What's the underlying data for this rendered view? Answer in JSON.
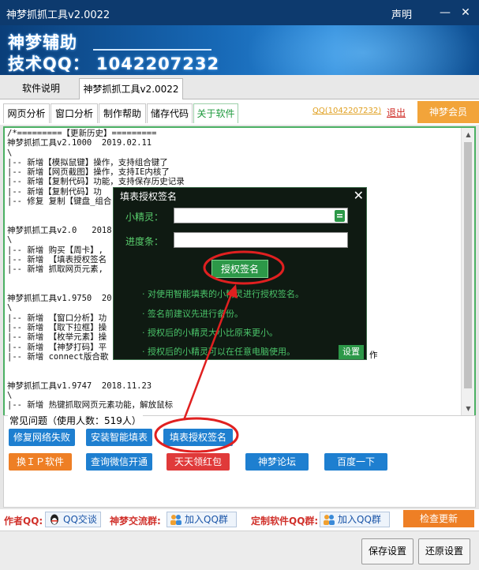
{
  "window": {
    "title": "神梦抓抓工具v2.0022",
    "declaration": "声明",
    "minimize": "—",
    "close": "✕"
  },
  "banner": {
    "line1": "神梦辅助",
    "line2": "技术QQ： 1042207232"
  },
  "top_tabs": [
    {
      "label": "软件说明",
      "selected": false
    },
    {
      "label": "神梦抓抓工具v2.0022",
      "selected": true
    }
  ],
  "sub_tabs": [
    {
      "label": "网页分析",
      "selected": false
    },
    {
      "label": "窗口分析",
      "selected": false
    },
    {
      "label": "制作帮助",
      "selected": false
    },
    {
      "label": "储存代码",
      "selected": false
    },
    {
      "label": "关于软件",
      "selected": true
    }
  ],
  "header_links": {
    "qq": "QQ(1042207232)",
    "exit": "退出",
    "member": "神梦会员"
  },
  "history_text": "/*=========【更新历史】=========\n神梦抓抓工具v2.1000  2019.02.11\n\\\n|-- 新增【模拟鼠键】操作，支持组合键了\n|-- 新增【网页截图】操作，支持IE内核了\n|-- 新增【复制代码】功能，支持保存历史记录\n|-- 新增【复制代码】功\n|-- 修复 复制【键盘_组合\n\n\n神梦抓抓工具v2.0   2018.\n\\\n|-- 新增 购买【周卡】,\n|-- 新增 【填表授权签名\n|-- 新增 抓取网页元素,\n\n\n神梦抓抓工具v1.9750  20\n\\\n|-- 新增 【窗口分析】功\n|-- 新增 【取下拉框】操\n|-- 新增 【枚举元素】操\n|-- 新增 【神梦打码】平\n|-- 新增 connect版合歌\n\n\n神梦抓抓工具v1.9747  2018.11.23\n\\\n|-- 新增 热键抓取网页元素功能，解放鼠标",
  "history_tail": "作",
  "dialog": {
    "title": "填表授权签名",
    "close": "✕",
    "label_sprite": "小精灵：",
    "label_progress": "进度条：",
    "sprite_value": "",
    "progress_value": "",
    "auth_button": "授权签名",
    "notes": [
      "· 对使用智能填表的小精灵进行授权签名。",
      "· 签名前建议先进行备份。",
      "· 授权后的小精灵大小比原来更小。",
      "· 授权后的小精灵可以在任意电脑使用。"
    ],
    "settings_button": "设置"
  },
  "faq": {
    "legend": "常见问题（使用人数：519人）",
    "buttons": [
      {
        "label": "修复网络失败",
        "color": "#1e7fd0"
      },
      {
        "label": "安装智能填表",
        "color": "#1e7fd0"
      },
      {
        "label": "填表授权签名",
        "color": "#1e7fd0"
      },
      {
        "label": "换ＩＰ软件",
        "color": "#ee7f25"
      },
      {
        "label": "查询微信开通",
        "color": "#1e7fd0"
      },
      {
        "label": "天天领红包",
        "color": "#e03a3a"
      },
      {
        "label": "神梦论坛",
        "color": "#1e7fd0"
      },
      {
        "label": "百度一下",
        "color": "#1e7fd0"
      }
    ]
  },
  "footer": {
    "author_qq_label": "作者QQ:",
    "qq_chat": "QQ交谈",
    "group_label": "神梦交流群:",
    "join_group_1": "加入QQ群",
    "custom_label": "定制软件QQ群:",
    "join_group_2": "加入QQ群",
    "update": "检查更新"
  },
  "bottom": {
    "save": "保存设置",
    "restore": "还原设置"
  },
  "colors": {
    "titlebar": "#0d3a6e",
    "accent_green": "#2c9848",
    "annotation_red": "#e02020"
  }
}
